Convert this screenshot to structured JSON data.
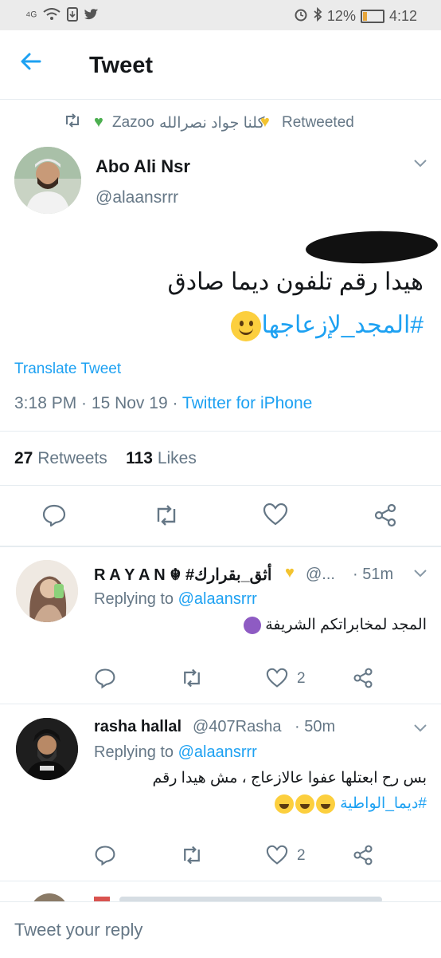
{
  "status_bar": {
    "signal": "⁴ᴳ",
    "battery_percent": "12%",
    "time": "4:12"
  },
  "header": {
    "title": "Tweet"
  },
  "retweet_line": {
    "name_arabic": "كلنا جواد نصرالله",
    "name_latin": "Zazoo",
    "label": "Retweeted"
  },
  "tweet": {
    "author_name": "Abo Ali Nsr",
    "author_handle": "@alaansrrr",
    "text": "هيدا رقم تلفون ديما صادق",
    "hashtag": "#المجد_لإزعاجها",
    "translate_label": "Translate Tweet",
    "time": "3:18 PM",
    "date": "15 Nov 19",
    "source": "Twitter for iPhone",
    "retweets_count": "27",
    "retweets_label": "Retweets",
    "likes_count": "113",
    "likes_label": "Likes"
  },
  "replies": [
    {
      "name": "R A Y A N ☬ #أثق_بقرارك",
      "handle": "@...",
      "time": "51m",
      "replying_prefix": "Replying to",
      "replying_handle": "@alaansrrr",
      "text": "المجد لمخابراتكم الشريفة",
      "likes": "2"
    },
    {
      "name": "rasha hallal",
      "handle": "@407Rasha",
      "time": "50m",
      "replying_prefix": "Replying to",
      "replying_handle": "@alaansrrr",
      "text": "بس رح ابعتلها عفوا عالازعاج ، مش هيدا رقم",
      "hashtag": "#ديما_الواطية",
      "likes": "2"
    }
  ],
  "composer": {
    "placeholder": "Tweet your reply"
  },
  "colors": {
    "accent": "#1da1f2",
    "muted": "#657786",
    "divider": "#e6ecf0"
  }
}
